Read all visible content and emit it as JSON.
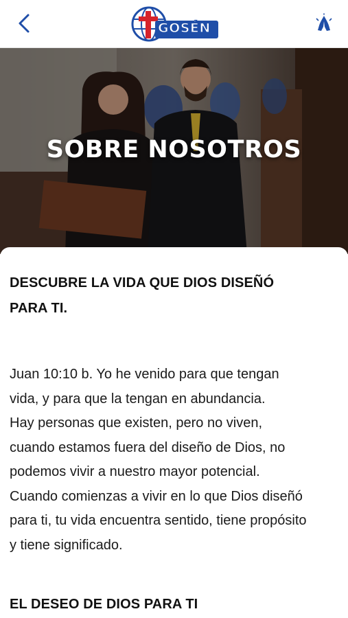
{
  "header": {
    "back_icon": "chevron-left-icon",
    "logo_text": "GOSÉN",
    "prayer_icon": "praying-hands-icon",
    "accent_color": "#1f4ea8",
    "logo_red": "#d6232a"
  },
  "hero": {
    "title": "SOBRE NOSOTROS"
  },
  "content": {
    "heading1_line1": "DESCUBRE LA VIDA QUE DIOS DISEÑÓ",
    "heading1_line2": "PARA TI.",
    "paragraph_lines": [
      "Juan 10:10 b. Yo he venido para que tengan",
      "vida, y para que la tengan en abundancia.",
      "Hay personas que existen, pero no viven,",
      "cuando estamos fuera del diseño de Dios, no",
      "podemos vivir a nuestro mayor potencial.",
      "Cuando comienzas a vivir en lo que Dios diseñó",
      "para ti, tu vida encuentra sentido, tiene propósito",
      "y tiene significado."
    ],
    "heading2": "EL DESEO DE DIOS PARA TI"
  }
}
